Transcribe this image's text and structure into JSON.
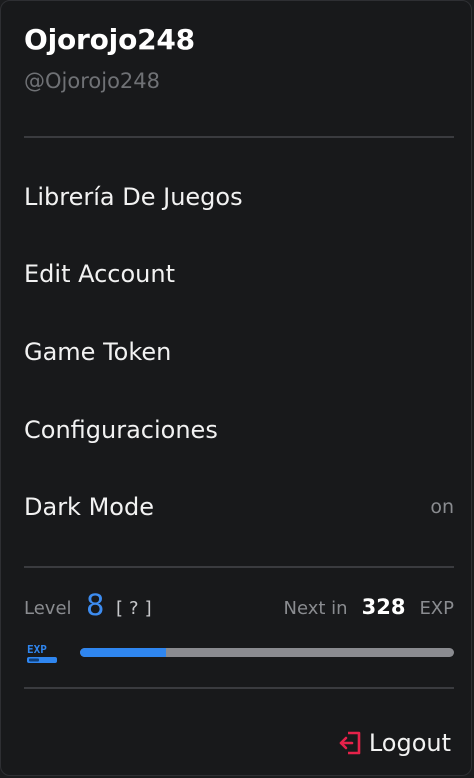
{
  "profile": {
    "username": "Ojorojo248",
    "handle": "@Ojorojo248"
  },
  "menu": {
    "items": [
      {
        "label": "Librería De Juegos"
      },
      {
        "label": "Edit Account"
      },
      {
        "label": "Game Token"
      },
      {
        "label": "Configuraciones"
      },
      {
        "label": "Dark Mode",
        "value": "on"
      }
    ]
  },
  "level": {
    "label": "Level",
    "number": "8",
    "help": "[?]",
    "next_label": "Next in",
    "next_value": "328",
    "next_unit": "EXP",
    "exp_icon_text": "EXP",
    "progress": 0.23
  },
  "logout": {
    "label": "Logout"
  },
  "colors": {
    "accent_blue": "#2f86f0",
    "logout_red": "#e5224a"
  },
  "icons": {
    "exp": "exp-badge-icon",
    "logout": "logout-door-icon"
  }
}
